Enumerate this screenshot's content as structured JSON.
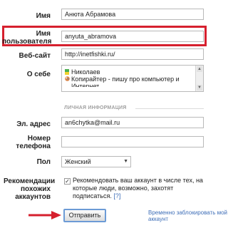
{
  "form": {
    "name": {
      "label": "Имя",
      "value": "Анюта Абрамова"
    },
    "username": {
      "label": "Имя пользователя",
      "value": "anyuta_abramova"
    },
    "website": {
      "label": "Веб-сайт",
      "value": "http://inetfishki.ru/"
    },
    "about": {
      "label": "О себе",
      "line1": "Николаев",
      "line2": "Копирайтер - пишу про компьютер и",
      "line3": "Интернет"
    },
    "private_section": "ЛИЧНАЯ ИНФОРМАЦИЯ",
    "email": {
      "label": "Эл. адрес",
      "value": "an6chytka@mail.ru"
    },
    "phone": {
      "label": "Номер телефона",
      "value": ""
    },
    "gender": {
      "label": "Пол",
      "value": "Женский"
    },
    "recommendations": {
      "label": "Рекомендации похожих аккаунтов",
      "text": "Рекомендовать ваш аккаунт в числе тех, на которые люди, возможно, захотят подписаться.",
      "help": "[?]",
      "checked": true
    }
  },
  "actions": {
    "submit_label": "Отправить",
    "block_link": "Временно заблокировать мой аккаунт"
  },
  "colors": {
    "highlight": "#d6202e",
    "link": "#3f6fb8"
  }
}
